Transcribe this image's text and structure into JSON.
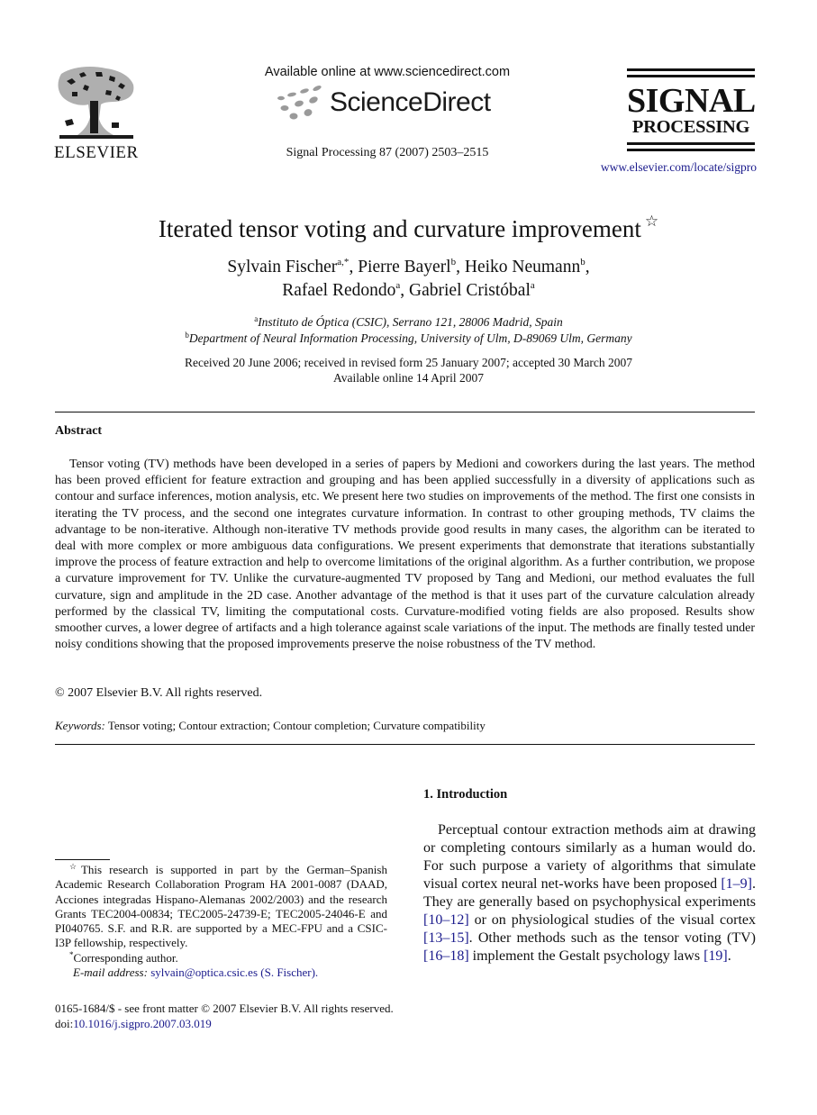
{
  "header": {
    "publisher_logo": {
      "icon": "elsevier-tree-icon",
      "wordmark": "ELSEVIER"
    },
    "sciencedirect": {
      "available_online": "Available online at www.sciencedirect.com",
      "wordmark": "ScienceDirect",
      "icon": "sciencedirect-dots-icon"
    },
    "journal_citation": "Signal Processing 87 (2007) 2503–2515",
    "journal_logo": {
      "line1": "SIGNAL",
      "line2": "PROCESSING"
    },
    "journal_url": "www.elsevier.com/locate/sigpro"
  },
  "paper": {
    "title": "Iterated tensor voting and curvature improvement",
    "title_footnote_mark": "☆",
    "authors": [
      {
        "name": "Sylvain Fischer",
        "affil": "a,*",
        "sep": ", "
      },
      {
        "name": "Pierre Bayerl",
        "affil": "b",
        "sep": ", "
      },
      {
        "name": "Heiko Neumann",
        "affil": "b",
        "sep": ","
      },
      {
        "name": "Rafael Redondo",
        "affil": "a",
        "sep": ", "
      },
      {
        "name": "Gabriel Cristóbal",
        "affil": "a",
        "sep": ""
      }
    ],
    "affiliations": [
      {
        "mark": "a",
        "text": "Instituto de Óptica (CSIC), Serrano 121, 28006 Madrid, Spain"
      },
      {
        "mark": "b",
        "text": "Department of Neural Information Processing, University of Ulm, D-89069 Ulm, Germany"
      }
    ],
    "dates": {
      "received": "Received 20 June 2006; received in revised form 25 January 2007; accepted 30 March 2007",
      "online": "Available online 14 April 2007"
    }
  },
  "abstract": {
    "heading": "Abstract",
    "text": "Tensor voting (TV) methods have been developed in a series of papers by Medioni and coworkers during the last years. The method has been proved efficient for feature extraction and grouping and has been applied successfully in a diversity of applications such as contour and surface inferences, motion analysis, etc. We present here two studies on improvements of the method. The first one consists in iterating the TV process, and the second one integrates curvature information. In contrast to other grouping methods, TV claims the advantage to be non-iterative. Although non-iterative TV methods provide good results in many cases, the algorithm can be iterated to deal with more complex or more ambiguous data configurations. We present experiments that demonstrate that iterations substantially improve the process of feature extraction and help to overcome limitations of the original algorithm. As a further contribution, we propose a curvature improvement for TV. Unlike the curvature-augmented TV proposed by Tang and Medioni, our method evaluates the full curvature, sign and amplitude in the 2D case. Another advantage of the method is that it uses part of the curvature calculation already performed by the classical TV, limiting the computational costs. Curvature-modified voting fields are also proposed. Results show smoother curves, a lower degree of artifacts and a high tolerance against scale variations of the input. The methods are finally tested under noisy conditions showing that the proposed improvements preserve the noise robustness of the TV method.",
    "copyright": "© 2007 Elsevier B.V. All rights reserved."
  },
  "keywords": {
    "label": "Keywords:",
    "items": "Tensor voting; Contour extraction; Contour completion; Curvature compatibility"
  },
  "introduction": {
    "heading": "1.  Introduction",
    "segments": [
      {
        "text": "Perceptual contour extraction methods aim at drawing or completing contours similarly as a human would do. For such purpose a variety of algorithms that simulate visual cortex neural net-works have been proposed ",
        "link": false
      },
      {
        "text": "[1–9]",
        "link": true
      },
      {
        "text": ". They are generally based on psychophysical experiments ",
        "link": false
      },
      {
        "text": "[10–12]",
        "link": true
      },
      {
        "text": " or on physiological studies of the visual cortex ",
        "link": false
      },
      {
        "text": "[13–15]",
        "link": true
      },
      {
        "text": ". Other methods such as the tensor voting (TV) ",
        "link": false
      },
      {
        "text": "[16–18]",
        "link": true
      },
      {
        "text": " implement the Gestalt psychology laws ",
        "link": false
      },
      {
        "text": "[19]",
        "link": true
      },
      {
        "text": ".",
        "link": false
      }
    ]
  },
  "footnotes": {
    "funding_mark": "☆",
    "funding": "This research is supported in part by the German–Spanish Academic Research Collaboration Program HA 2001-0087 (DAAD, Acciones integradas Hispano-Alemanas 2002/2003) and the research Grants TEC2004-00834; TEC2005-24739-E; TEC2005-24046-E and PI040765. S.F. and R.R. are supported by a MEC-FPU and a CSIC-I3P fellowship, respectively.",
    "corresponding_mark": "*",
    "corresponding": "Corresponding author.",
    "email_label": "E-mail address:",
    "email_value": "sylvain@optica.csic.es (S. Fischer)."
  },
  "front_matter": {
    "issn_line": "0165-1684/$ - see front matter © 2007 Elsevier B.V. All rights reserved.",
    "doi_label": "doi:",
    "doi_value": "10.1016/j.sigpro.2007.03.019"
  },
  "colors": {
    "text": "#111111",
    "link": "#1a1a8c",
    "sciencedirect_dots": "#9a9a9a"
  }
}
